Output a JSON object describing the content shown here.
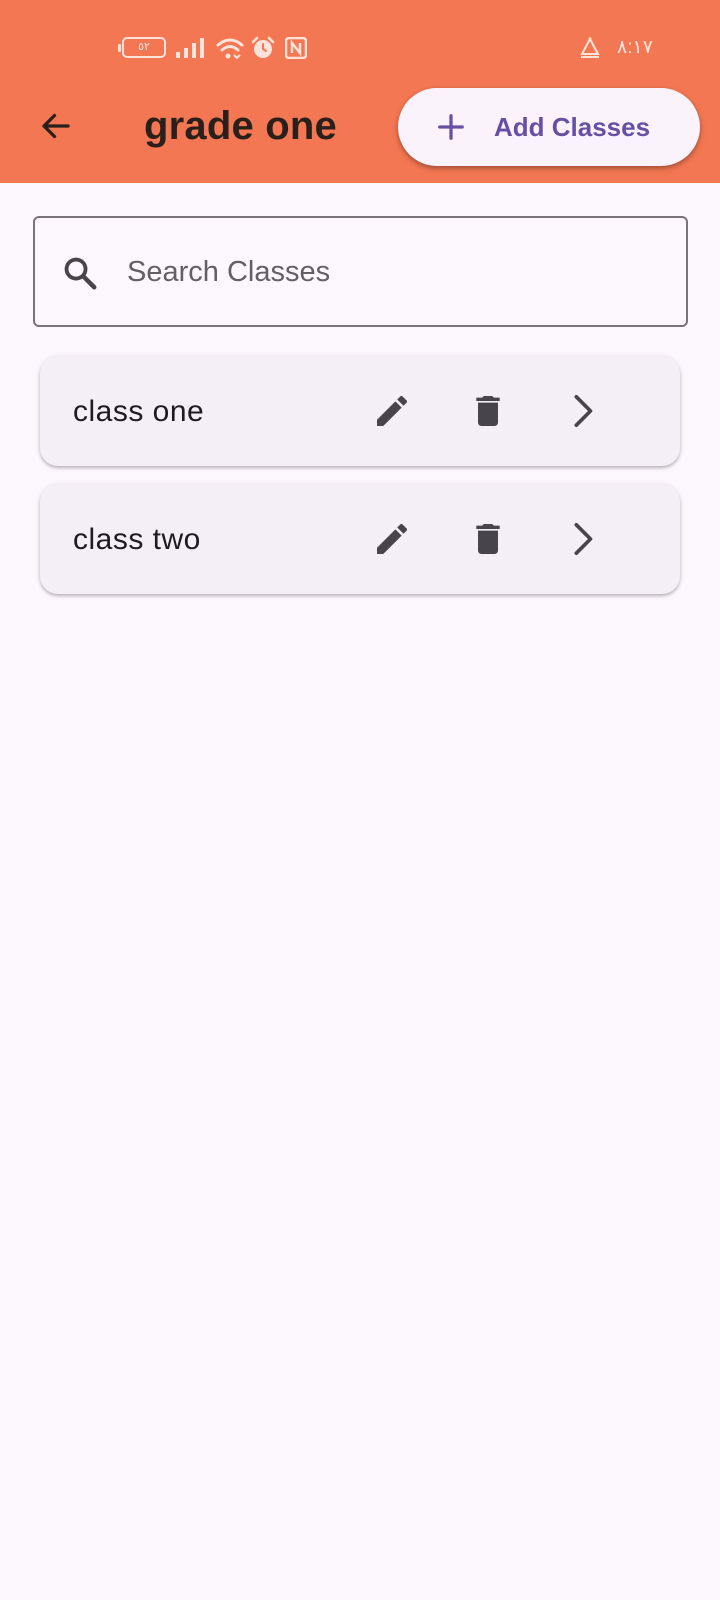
{
  "status_bar": {
    "battery_level": "٥٢",
    "time": "٨:١٧"
  },
  "header": {
    "title": "grade one",
    "add_button_label": "Add Classes"
  },
  "search": {
    "placeholder": "Search Classes",
    "value": ""
  },
  "classes": [
    {
      "name": "class one"
    },
    {
      "name": "class two"
    }
  ],
  "icons": {
    "back": "arrow-left-icon",
    "add": "plus-icon",
    "search": "search-icon",
    "edit": "pencil-icon",
    "delete": "trash-icon",
    "open": "chevron-right-icon"
  },
  "colors": {
    "header_bg": "#f37752",
    "page_bg": "#fcf6fd",
    "accent": "#6750a4",
    "card_bg": "#f4eff6",
    "icon": "#48444b"
  }
}
